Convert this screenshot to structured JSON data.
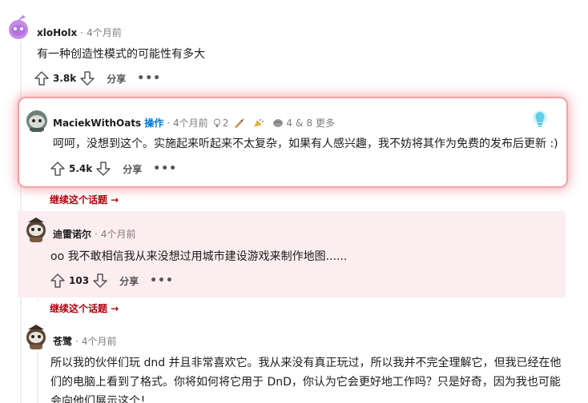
{
  "comments": [
    {
      "author": "xloHolx",
      "time": "4个月前",
      "body": "有一种创造性模式的可能性有多大",
      "score": "3.8k",
      "share_label": "分享"
    },
    {
      "author": "MaciekWithOats",
      "op_badge": "操作",
      "time": "4个月前",
      "awards": {
        "count_1": "2",
        "count_2": "4",
        "count_3": "8",
        "more_label": "更多"
      },
      "body": "呵呵，没想到这个。实施起来听起来不太复杂，如果有人感兴趣，我不妨将其作为免费的发布后更新 :)",
      "score": "5.4k",
      "share_label": "分享"
    },
    {
      "author": "迪雷诺尔",
      "time": "4个月前",
      "body": "oo 我不敢相信我从来没想过用城市建设游戏来制作地图......",
      "score": "103",
      "share_label": "分享"
    },
    {
      "author": "苍鹭",
      "time": "4个月前",
      "body_lines": [
        "所以我的伙伴们玩 dnd 并且非常喜欢它。我从来没有真正玩过，所以我并不完全理解它，但我已经在他",
        "们的电脑上看到了格式。你将如何将它用于 DnD，你认为它会更好地工作吗？只是好奇，因为我也可能",
        "会向他们展示这个！"
      ]
    }
  ],
  "continue_thread": [
    "继续这个话题 →",
    "继续这个话题 →"
  ],
  "colors": {
    "accent_link": "#b3000c",
    "op_blue": "#0079d3",
    "highlight_glow": "#e6505a",
    "pink_bg": "#fcedf0"
  },
  "icons": [
    "upvote-icon",
    "downvote-icon",
    "share-icon",
    "more-icon",
    "lightbulb-icon"
  ]
}
